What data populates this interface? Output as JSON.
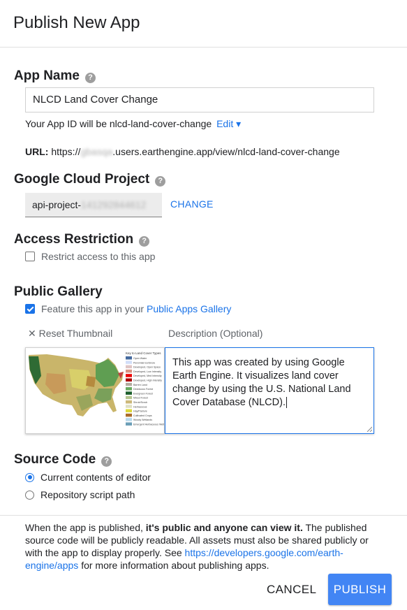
{
  "header": {
    "title": "Publish New App"
  },
  "app_name": {
    "label": "App Name",
    "value": "NLCD Land Cover Change",
    "app_id_prefix": "Your App ID will be nlcd-land-cover-change",
    "edit_label": "Edit ▾",
    "url_label": "URL:",
    "url_prefix": "https://",
    "url_user_blurred": "gbasqa",
    "url_suffix": ".users.earthengine.app/view/nlcd-land-cover-change"
  },
  "cloud_project": {
    "label": "Google Cloud Project",
    "value_prefix": "api-project-",
    "value_blurred": "141292844612",
    "change_label": "CHANGE"
  },
  "access": {
    "label": "Access Restriction",
    "checkbox_label": "Restrict access to this app",
    "checked": false
  },
  "gallery": {
    "label": "Public Gallery",
    "feature_label": "Feature this app in your",
    "gallery_link": "Public Apps Gallery",
    "feature_checked": true,
    "reset_thumbnail": "✕ Reset Thumbnail",
    "description_label": "Description (Optional)",
    "description": "This app was created by using Google Earth Engine. It visualizes land cover change by using the U.S. National Land Cover Database (NLCD).",
    "thumbnail_legend_title": "Key to Land Cover Types",
    "thumbnail_legend": [
      {
        "label": "Open Water",
        "color": "#466b9f"
      },
      {
        "label": "Perennial Ice/Snow",
        "color": "#d1def8"
      },
      {
        "label": "Developed, Open Space",
        "color": "#dec5c5"
      },
      {
        "label": "Developed, Low Intensity",
        "color": "#d99282"
      },
      {
        "label": "Developed, Med Intensity",
        "color": "#eb0000"
      },
      {
        "label": "Developed, High Intensity",
        "color": "#ab0000"
      },
      {
        "label": "Barren Land",
        "color": "#b3ac9f"
      },
      {
        "label": "Deciduous Forest",
        "color": "#68ab5f"
      },
      {
        "label": "Evergreen Forest",
        "color": "#1c5f2c"
      },
      {
        "label": "Mixed Forest",
        "color": "#b5c58f"
      },
      {
        "label": "Shrub/Scrub",
        "color": "#ccb879"
      },
      {
        "label": "Herbaceous",
        "color": "#dfdfc2"
      },
      {
        "label": "Hay/Pasture",
        "color": "#dcd939"
      },
      {
        "label": "Cultivated Crops",
        "color": "#ab6c28"
      },
      {
        "label": "Woody Wetlands",
        "color": "#b8d9eb"
      },
      {
        "label": "Emergent Herbaceous Wetlands",
        "color": "#6c9fb8"
      }
    ]
  },
  "source": {
    "label": "Source Code",
    "option_current": "Current contents of editor",
    "option_repo": "Repository script path",
    "selected": "current"
  },
  "footer": {
    "text_before": "When the app is published,",
    "text_bold": "it's public and anyone can view it.",
    "text_after": "The published source code will be publicly readable. All assets must also be shared publicly or with the app to display properly. See",
    "link": "https://developers.google.com/earth-engine/apps",
    "text_end": "for more information about publishing apps.",
    "cancel_label": "CANCEL",
    "publish_label": "PUBLISH"
  },
  "colors": {
    "accent": "#1a73e8",
    "publish_bg": "#4285f4"
  }
}
